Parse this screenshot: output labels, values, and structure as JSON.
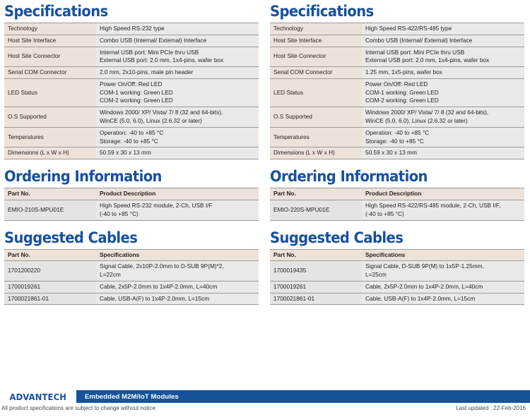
{
  "columns": [
    {
      "specifications": {
        "heading": "Specifications",
        "rows": [
          {
            "key": "Technology",
            "value": "High Speed RS-232 type"
          },
          {
            "key": "Host Site Interface",
            "value": "Combo USB (Internal/ External) Interface"
          },
          {
            "key": "Host Site Connector",
            "value": "Internal USB port: Mini PCIe thru USB\nExternal USB port: 2.0 mm, 1x4-pins, wafer box"
          },
          {
            "key": "Serial COM Connector",
            "value": "2.0 mm, 2x10-pins, male pin header"
          },
          {
            "key": "LED Status",
            "value": "Power On/Off: Red LED\nCOM-1 working: Green LED\nCOM-2 working: Green LED"
          },
          {
            "key": "O.S Supported",
            "value": "Windows 2000/ XP/ Vista/ 7/ 8 (32 and 64-bits),\nWinCE (5.0, 6.0), Linux (2.6.32 or later)"
          },
          {
            "key": "Temperatures",
            "value": "Operation: -40 to +85 °C\nStorage: -40 to +85 °C"
          },
          {
            "key": "Dimensions (L x W x H)",
            "value": "50.59 x 30 x 13 mm"
          }
        ]
      },
      "ordering": {
        "heading": "Ordering Information",
        "headers": [
          "Part No.",
          "Product Description"
        ],
        "rows": [
          {
            "part": "EMIO-210S-MPU01E",
            "desc": "High Speed RS-232 module, 2-Ch, USB I/F\n(-40 to +85 °C)"
          }
        ]
      },
      "cables": {
        "heading": "Suggested Cables",
        "headers": [
          "Part No.",
          "Specifications"
        ],
        "rows": [
          {
            "part": "1701200220",
            "desc": "Signal Cable, 2x10P-2.0mm to D-SUB 9P(M)*2,\nL=22cm"
          },
          {
            "part": "1700019261",
            "desc": "Cable, 2x5P-2.0mm to 1x4P-2.0mm, L=40cm"
          },
          {
            "part": "1700021861-01",
            "desc": "Cable, USB-A(F) to 1x4P-2.0mm, L=15cm"
          }
        ]
      }
    },
    {
      "specifications": {
        "heading": "Specifications",
        "rows": [
          {
            "key": "Technology",
            "value": "High Speed RS-422/RS-485 type"
          },
          {
            "key": "Host Site Interface",
            "value": "Combo USB (Internal/ External) Interface"
          },
          {
            "key": "Host Site Connector",
            "value": "Internal USB port: Mini PCIe thru USB\nExternal USB port: 2.0 mm, 1x4-pins, wafer box"
          },
          {
            "key": "Serial COM Connector",
            "value": "1.25 mm, 1x5-pins, wafer box"
          },
          {
            "key": "LED Status",
            "value": "Power On/Off: Red LED\nCOM-1 working: Green LED\nCOM-2 working: Green LED"
          },
          {
            "key": "O.S Supported",
            "value": "Windows 2000/ XP/ Vista/ 7/ 8 (32 and 64-bits),\nWinCE (5.0, 6.0), Linux (2.6.32 or later)"
          },
          {
            "key": "Temperatures",
            "value": "Operation: -40 to +85 °C\nStorage: -40 to +85 °C"
          },
          {
            "key": "Dimensions (L x W x H)",
            "value": "50.59 x 30 x 13 mm"
          }
        ]
      },
      "ordering": {
        "heading": "Ordering Information",
        "headers": [
          "Part No.",
          "Product Description"
        ],
        "rows": [
          {
            "part": "EMIO-220S-MPU01E",
            "desc": "High Speed RS-422/RS-485 module, 2-Ch, USB I/F,\n(-40 to +85 °C)"
          }
        ]
      },
      "cables": {
        "heading": "Suggested Cables",
        "headers": [
          "Part No.",
          "Specifications"
        ],
        "rows": [
          {
            "part": "1700019435",
            "desc": "Signal Cable, D-SUB 9P(M) to 1x5P-1.25mm,\nL=25cm"
          },
          {
            "part": "1700019261",
            "desc": "Cable, 2x5P-2.0mm to 1x4P-2.0mm, L=40cm"
          },
          {
            "part": "1700021861-01",
            "desc": "Cable, USB-A(F) to 1x4P-2.0mm, L=15cm"
          }
        ]
      }
    }
  ],
  "footer": {
    "logo": "ADVANTECH",
    "bar_label": "Embedded M2M/IoT Modules",
    "footnote": "All product specifications are subject to change without notice",
    "last_updated": "Last updated : 22-Feb-2016"
  },
  "colors": {
    "brand_blue": "#17519E",
    "bar_blue": "#16539B",
    "beige_row": "#EDE2D9",
    "gray_row": "#E9E9E9",
    "rule": "#9b9b97"
  }
}
